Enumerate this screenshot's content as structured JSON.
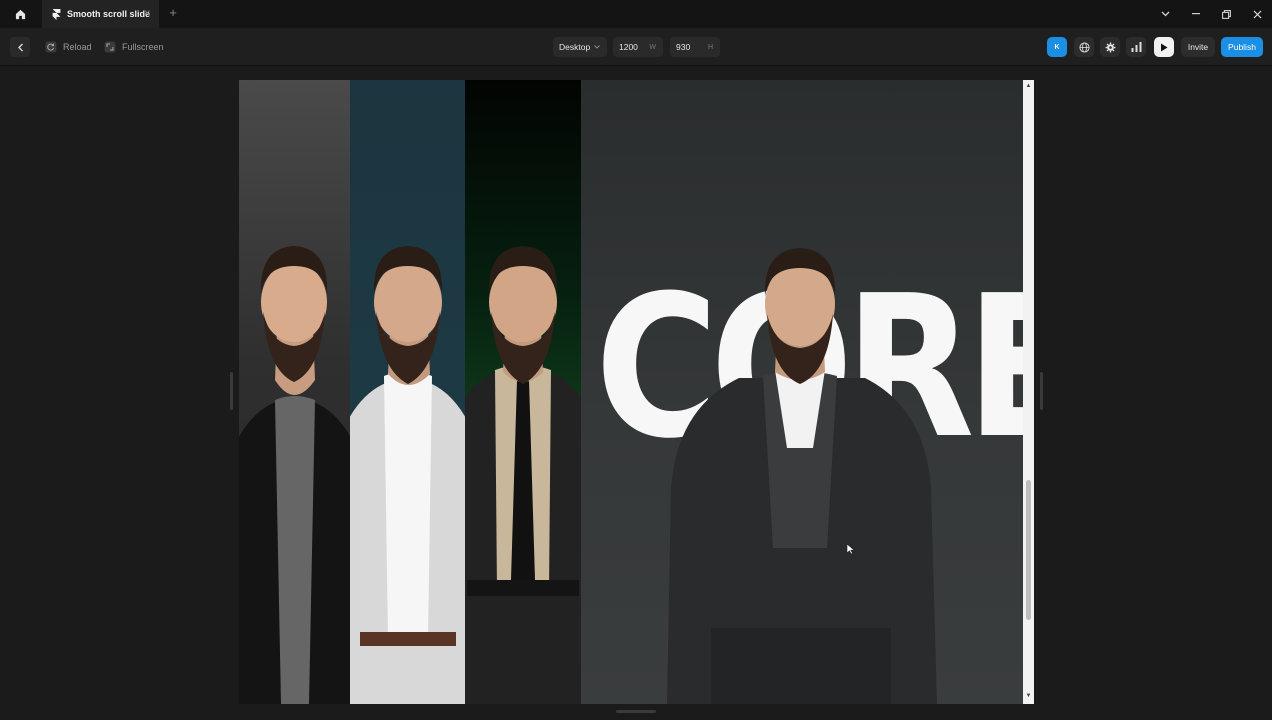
{
  "titlebar": {
    "tab_title": "Smooth scroll slide"
  },
  "toolbar": {
    "reload_label": "Reload",
    "fullscreen_label": "Fullscreen",
    "breakpoint": "Desktop",
    "width_value": "1200",
    "width_suffix": "W",
    "height_value": "930",
    "height_suffix": "H",
    "badge_label": "K",
    "invite_label": "Invite",
    "publish_label": "Publish"
  },
  "preview": {
    "hero_word": "CORE",
    "panel_colors": [
      "#3a3a3a",
      "#1d3a44",
      "#0f3a1a",
      "#2f3233"
    ]
  },
  "colors": {
    "accent": "#1a8fe3",
    "background": "#1b1b1b",
    "toolbar": "#1f1f1f"
  },
  "icons": [
    "home-icon",
    "framer-logo-icon",
    "close-icon",
    "plus-icon",
    "chevron-down-icon",
    "minimize-icon",
    "restore-icon",
    "window-close-icon",
    "back-arrow-icon",
    "reload-icon",
    "fullscreen-icon",
    "globe-icon",
    "gear-icon",
    "analytics-icon",
    "play-icon"
  ]
}
